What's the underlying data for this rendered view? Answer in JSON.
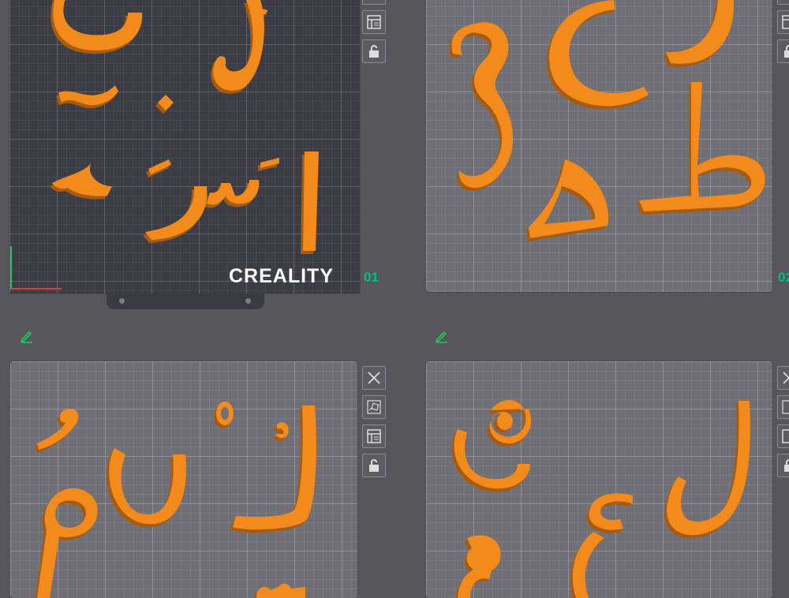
{
  "brand": {
    "name": "CREALITY"
  },
  "plates": [
    {
      "label": "01",
      "letters": [
        {
          "glyph": "ى"
        },
        {
          "glyph": "ب"
        },
        {
          "glyph": "آ"
        },
        {
          "glyph": "خ"
        },
        {
          "glyph": "ا"
        },
        {
          "glyph": "سَ"
        },
        {
          "glyph": "رَ"
        },
        {
          "glyph": "ء"
        }
      ]
    },
    {
      "label": "02",
      "letters": [
        {
          "glyph": "ق"
        },
        {
          "glyph": "ح"
        },
        {
          "glyph": "ص"
        },
        {
          "glyph": "ط"
        },
        {
          "glyph": "ه"
        }
      ]
    },
    {
      "letters": [
        {
          "glyph": "ُ"
        },
        {
          "glyph": "ْ"
        },
        {
          "glyph": "ك"
        },
        {
          "glyph": "م"
        },
        {
          "glyph": "ن"
        },
        {
          "glyph": "س"
        }
      ]
    },
    {
      "letters": [
        {
          "glyph": "ق"
        },
        {
          "glyph": "ل"
        },
        {
          "glyph": "ع"
        },
        {
          "glyph": "و"
        }
      ]
    }
  ],
  "toolbar_icons": [
    "close-icon",
    "auto-arrange-icon",
    "plate-settings-icon",
    "lock-icon"
  ],
  "colors": {
    "filament": "#f28a1a",
    "filament_shadow": "#a85a10",
    "active_plate": "#3c3c45",
    "plate": "#6f6f75",
    "plate_label": "#00c08a",
    "background": "#56565b"
  }
}
